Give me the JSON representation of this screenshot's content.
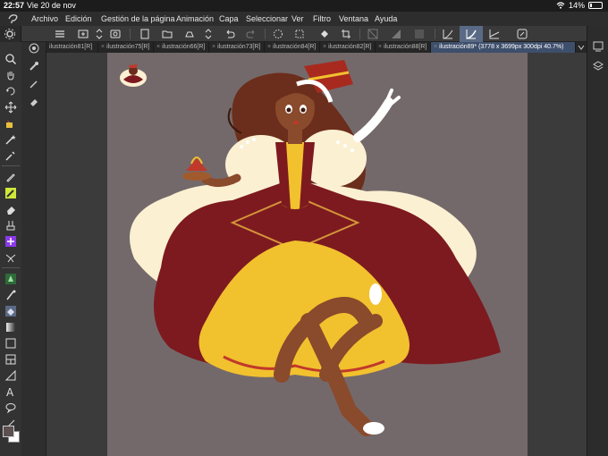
{
  "status": {
    "time": "22:57",
    "date": "Vie 20 de nov",
    "battery": "14%"
  },
  "menu": {
    "items": [
      "Archivo",
      "Edición",
      "Gestión de la página",
      "Animación",
      "Capa",
      "Seleccionar",
      "Ver",
      "Filtro",
      "Ventana",
      "Ayuda"
    ]
  },
  "tabs": [
    {
      "label": "ilustración81[R]",
      "active": false
    },
    {
      "label": "ilustración75[R]",
      "active": false
    },
    {
      "label": "ilustración66[R]",
      "active": false
    },
    {
      "label": "ilustración73[R]",
      "active": false
    },
    {
      "label": "ilustración84[R]",
      "active": false
    },
    {
      "label": "ilustración82[R]",
      "active": false
    },
    {
      "label": "ilustración88[R]",
      "active": false
    },
    {
      "label": "ilustración89* (3778 x 3699px 300dpi 40.7%)",
      "active": true
    }
  ],
  "colors": {
    "canvas_bg": "#74696a",
    "accent": "#5a6a86",
    "active_tab": "#3e4f6c",
    "dress_red": "#7d1a1f",
    "dress_yellow": "#f2c12e",
    "cream": "#fbf0d2",
    "hair": "#6b2e1c",
    "skin": "#8a4a2c"
  },
  "icons": {
    "toolbar": [
      "menu-icon",
      "new-canvas-icon",
      "eraser-layer-icon",
      "export-icon",
      "open-folder-icon",
      "save-icon",
      "undo-icon",
      "redo-icon",
      "selection-icon",
      "transform-icon",
      "fill-icon",
      "crop-icon",
      "color-icon",
      "pen-pressure-icon",
      "stabilizer-icon"
    ],
    "tools": [
      "zoom-icon",
      "hand-icon",
      "rotate-icon",
      "move-icon",
      "operation-icon",
      "magic-wand-icon",
      "eyedropper-icon",
      "pen-icon",
      "pencil-icon",
      "eraser-icon",
      "brush-icon",
      "airbrush-icon",
      "decoration-icon",
      "blend-icon",
      "fill-icon",
      "gradient-icon",
      "figure-icon",
      "frame-icon",
      "ruler-icon",
      "text-icon",
      "balloon-icon",
      "correction-icon"
    ]
  }
}
